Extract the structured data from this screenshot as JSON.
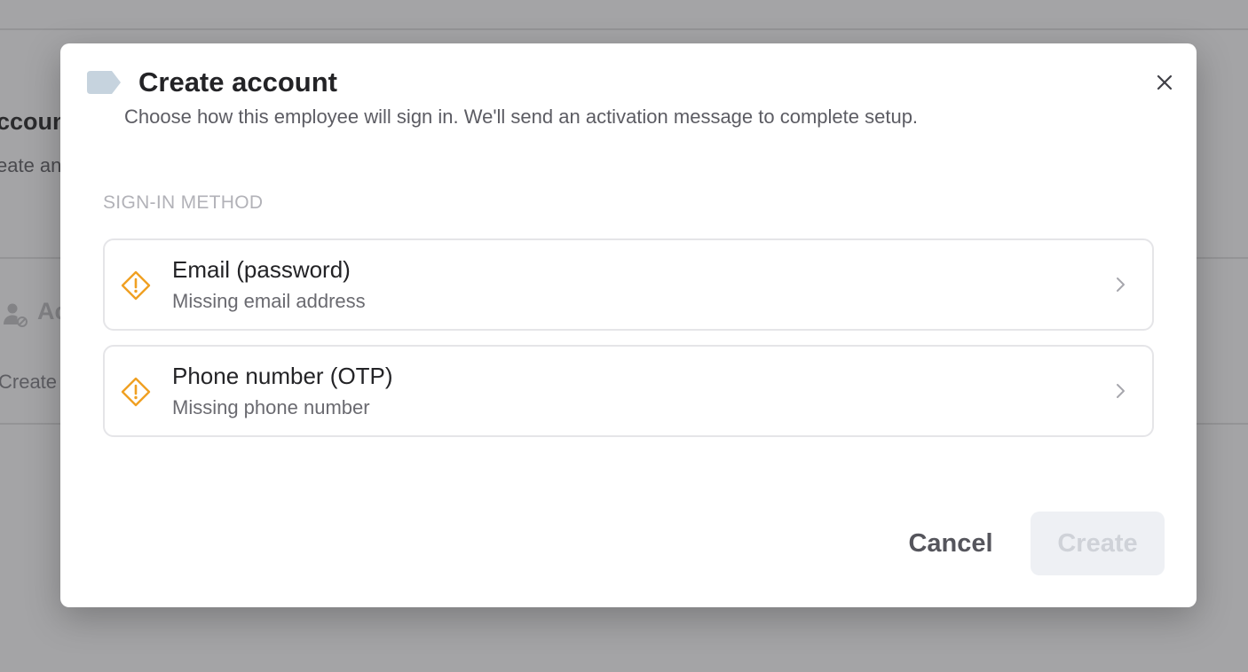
{
  "background": {
    "title_fragment": "ccoun",
    "subtitle_fragment": "eate an",
    "section_fragment": "Ac",
    "create_fragment": "Create"
  },
  "modal": {
    "title": "Create account",
    "description": "Choose how this employee will sign in. We'll send an activation message to complete setup.",
    "section_label": "SIGN-IN METHOD",
    "methods": [
      {
        "title": "Email (password)",
        "subtitle": "Missing email address",
        "icon": "warning-diamond-icon"
      },
      {
        "title": "Phone number (OTP)",
        "subtitle": "Missing phone number",
        "icon": "warning-diamond-icon"
      }
    ],
    "cancel_label": "Cancel",
    "create_label": "Create"
  },
  "colors": {
    "warning": "#f0a022",
    "tag": "#c6d3de",
    "disabled_button_bg": "#eef0f4",
    "disabled_button_text": "#cfd2d8"
  }
}
